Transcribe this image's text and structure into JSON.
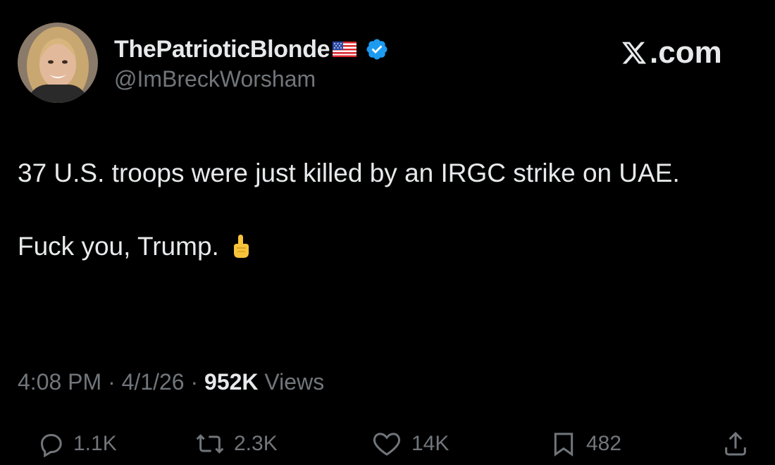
{
  "author": {
    "display_name": "ThePatrioticBlonde",
    "handle": "@ImBreckWorsham",
    "avatar_icon": "profile-photo",
    "flag_icon": "us-flag-icon",
    "verified_icon": "verified-badge-icon"
  },
  "watermark": {
    "text": ".com",
    "logo_icon": "x-logo-icon"
  },
  "tweet": {
    "line1": "37 U.S. troops were just killed by an IRGC strike on UAE.",
    "line2": "Fuck you, Trump.",
    "emoji_icon": "middle-finger-emoji-icon"
  },
  "meta": {
    "time": "4:08 PM",
    "separator": " · ",
    "date": "4/1/26",
    "views_count": "952K",
    "views_label": " Views"
  },
  "actions": {
    "replies": "1.1K",
    "reposts": "2.3K",
    "likes": "14K",
    "bookmarks": "482"
  },
  "colors": {
    "background": "#000000",
    "primary_text": "#e7e9ea",
    "secondary_text": "#71767b",
    "verified_blue": "#1d9bf0"
  }
}
